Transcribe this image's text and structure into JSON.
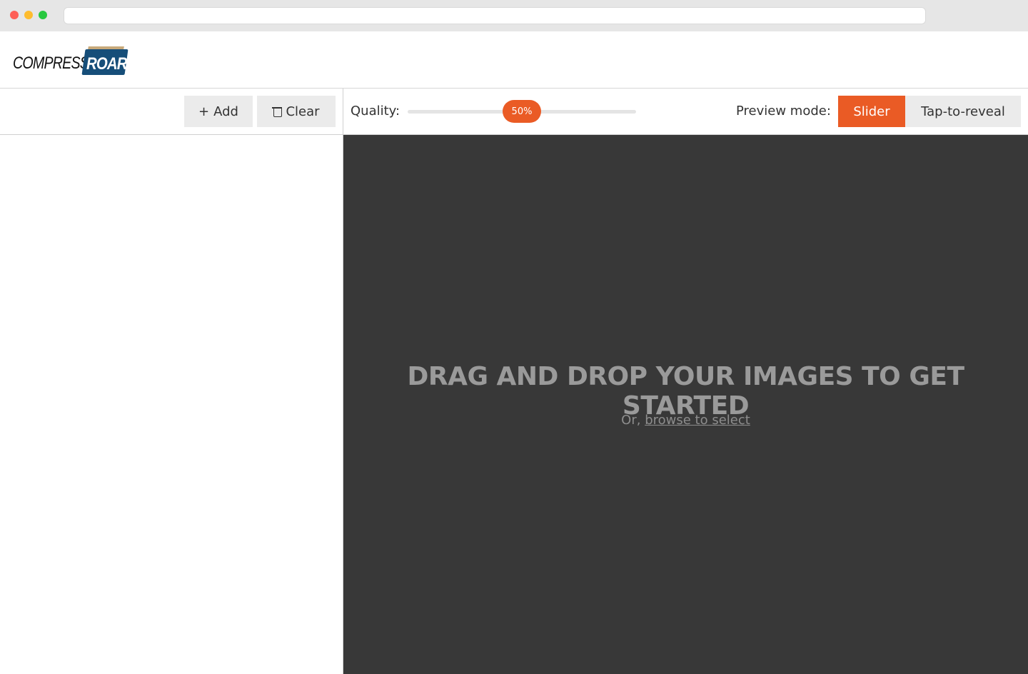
{
  "app": {
    "logo_word_1": "COMPRESS",
    "logo_word_2": "ROAR"
  },
  "left_toolbar": {
    "add_icon": "plus-icon",
    "add_label": "Add",
    "clear_icon": "trash-icon",
    "clear_label": "Clear"
  },
  "quality": {
    "label": "Quality:",
    "value_label": "50%",
    "value_fraction": 0.5
  },
  "preview_mode": {
    "label": "Preview mode:",
    "options": [
      "Slider",
      "Tap-to-reveal"
    ],
    "selected": "Slider"
  },
  "drop_zone": {
    "title": "DRAG AND DROP YOUR IMAGES TO GET STARTED",
    "sub_prefix": "Or, ",
    "browse_link": "browse to select"
  },
  "colors": {
    "accent": "#ea5b25",
    "drop_bg": "#383838",
    "logo_blue": "#164e79"
  }
}
